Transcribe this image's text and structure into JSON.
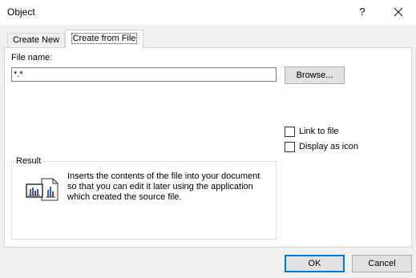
{
  "window": {
    "title": "Object",
    "help_label": "?"
  },
  "tabs": [
    {
      "label": "Create New",
      "mnemonic": "C"
    },
    {
      "label": "Create from File",
      "mnemonic": "F",
      "selected": true
    }
  ],
  "file": {
    "label": "File name:",
    "value": "*.*",
    "browse_label": "Browse..."
  },
  "options": {
    "link_label": "Link to file",
    "link_checked": false,
    "icon_label": "Display as icon",
    "icon_checked": false
  },
  "result": {
    "legend": "Result",
    "text": "Inserts the contents of the file into your document so that you can edit it later using the application which created the source file.",
    "icon": "document-chart-icon"
  },
  "footer": {
    "ok_label": "OK",
    "cancel_label": "Cancel"
  },
  "colors": {
    "accent": "#0078d7",
    "chart_blue": "#3060c8",
    "chart_red": "#c82020"
  }
}
